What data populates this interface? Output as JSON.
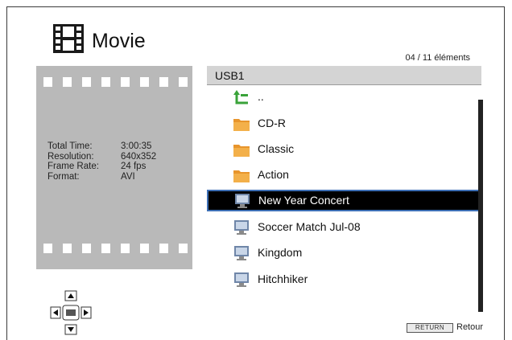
{
  "header": {
    "title": "Movie",
    "title_icon": "film-icon"
  },
  "info": {
    "rows": [
      {
        "label": "Total Time:",
        "value": "3:00:35"
      },
      {
        "label": "Resolution:",
        "value": "640x352"
      },
      {
        "label": "Frame Rate:",
        "value": "24 fps"
      },
      {
        "label": "Format:",
        "value": "AVI"
      }
    ]
  },
  "browser": {
    "count": "04 / 11 éléments",
    "path": "USB1",
    "items": [
      {
        "label": "..",
        "icon": "parent-folder-arrow-icon",
        "type": "parent"
      },
      {
        "label": "CD-R",
        "icon": "folder-icon",
        "type": "folder"
      },
      {
        "label": "Classic",
        "icon": "folder-icon",
        "type": "folder"
      },
      {
        "label": "Action",
        "icon": "folder-icon",
        "type": "folder"
      },
      {
        "label": "New Year Concert",
        "icon": "video-file-icon",
        "type": "video",
        "selected": true
      },
      {
        "label": "Soccer Match Jul-08",
        "icon": "video-file-icon",
        "type": "video"
      },
      {
        "label": "Kingdom",
        "icon": "video-file-icon",
        "type": "video"
      },
      {
        "label": "Hitchhiker",
        "icon": "video-file-icon",
        "type": "video"
      }
    ]
  },
  "footer": {
    "return_key": "RETURN",
    "return_label": "Retour"
  },
  "colors": {
    "accent": "#3d6fb5",
    "panel_gray": "#b9b9b9",
    "bar_gray": "#d4d4d4"
  }
}
